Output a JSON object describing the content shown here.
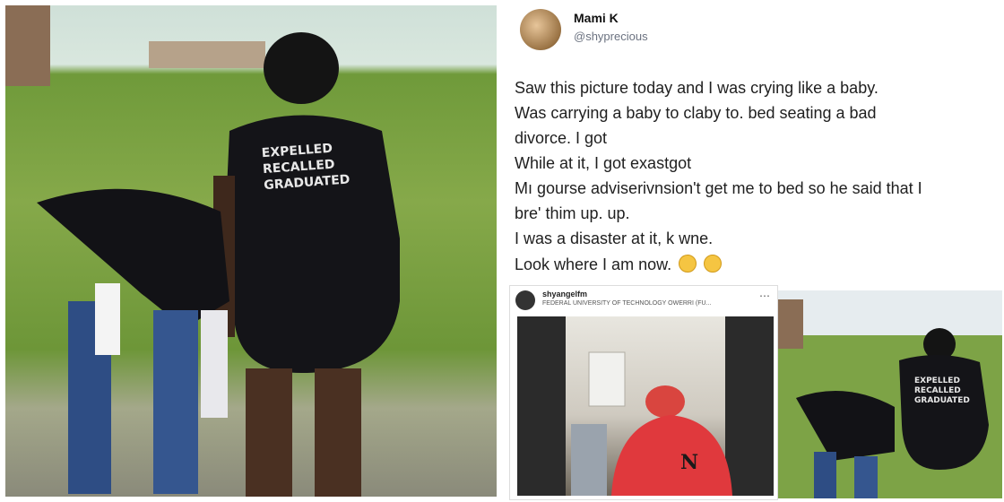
{
  "left_photo": {
    "shirt_text": [
      "EXPELLED",
      "RECALLED",
      "GRADUATED"
    ]
  },
  "tweet": {
    "display_name": "Mami K",
    "handle": "@shyprecious",
    "lines": [
      "Saw this picture today and I was crying like a baby.",
      "Was carrying a baby to claby to.        bed seating a bad",
      "divorce.                              I got",
      "While at it, I got exastgot",
      "Mı gourse adviserivnsion't get me to bed so he said that I",
      "bre' thim up.                  up.",
      "I was a disaster at it, k wne.",
      "Look where I am now."
    ]
  },
  "embed": {
    "user": "shyangelfm",
    "subtitle": "FEDERAL UNIVERSITY OF TECHNOLOGY OWERRI (FU...",
    "more": "⋯",
    "sweater_letter": "N"
  },
  "small_photo": {
    "shirt_text": [
      "EXPELLED",
      "RECALLED",
      "GRADUATED"
    ]
  }
}
